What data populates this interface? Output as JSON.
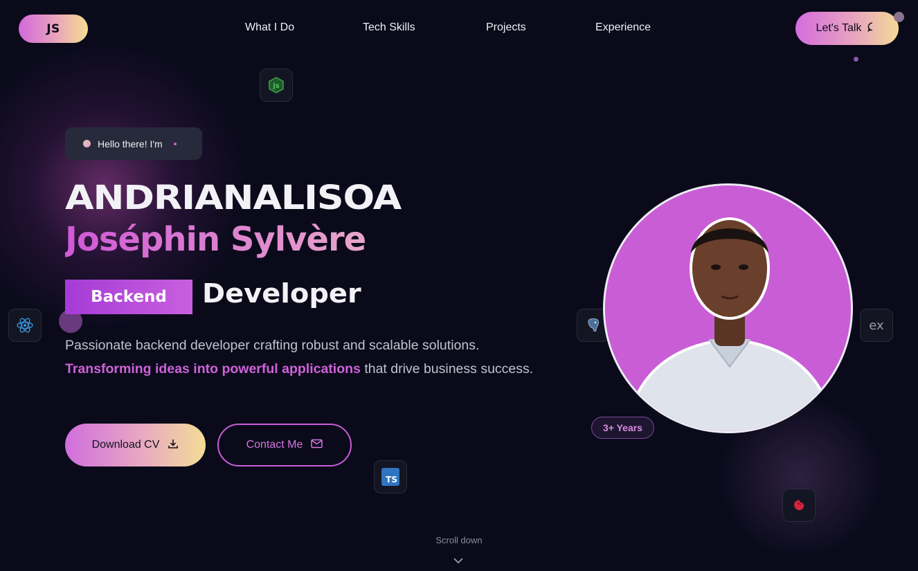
{
  "nav": {
    "logo": "JS",
    "links": [
      "What I Do",
      "Tech Skills",
      "Projects",
      "Experience"
    ],
    "cta_label": "Let's Talk"
  },
  "hero": {
    "greeting": "Hello there! I'm",
    "name_line1": "ANDRIANALISOA",
    "name_line2": "Joséphin Sylvère",
    "role_tag": "Backend",
    "role_word": "Developer",
    "description_part1": "Passionate backend developer crafting robust and scalable solutions.",
    "description_highlight": "Transforming ideas into powerful applications",
    "description_part2": "that drive business success.",
    "download_label": "Download CV",
    "contact_label": "Contact Me"
  },
  "profile": {
    "experience_badge": "3+ Years"
  },
  "tech_icons": [
    "nodejs-icon",
    "react-icon",
    "typescript-icon",
    "postgresql-icon",
    "express-icon",
    "nestjs-icon"
  ],
  "tech_labels": {
    "typescript": "TS",
    "express": "ex"
  },
  "scroll": {
    "label": "Scroll down"
  },
  "colors": {
    "background": "#0a0a1b",
    "accent_purple": "#c95dd6",
    "accent_gold": "#f4dc95",
    "text_muted": "#c2c3cc"
  }
}
